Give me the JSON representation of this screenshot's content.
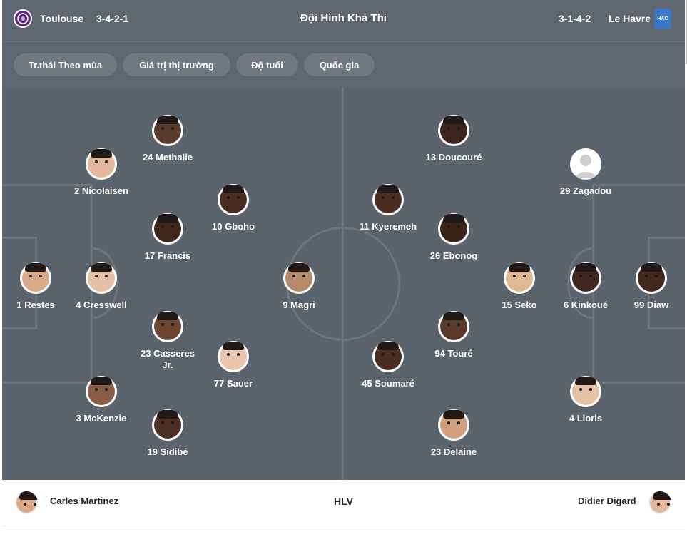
{
  "header": {
    "home_team": "Toulouse",
    "home_formation": "3-4-2-1",
    "title": "Đội Hình Khả Thi",
    "away_formation": "3-1-4-2",
    "away_team": "Le Havre",
    "away_logo_text": "HAC",
    "home_logo_icon": "toulouse-crest-icon",
    "away_logo_icon": "le-havre-crest-icon"
  },
  "tabs": [
    "Tr.thái Theo mùa",
    "Giá trị thị trường",
    "Độ tuổi",
    "Quốc gia"
  ],
  "home_players": [
    {
      "label": "24 Methalie",
      "skin": "#5a3a2a"
    },
    {
      "label": "2 Nicolaisen",
      "skin": "#e2b79a"
    },
    {
      "label": "10 Gboho",
      "skin": "#4a2e22"
    },
    {
      "label": "17 Francis",
      "skin": "#3f271c"
    },
    {
      "label": "1 Restes",
      "skin": "#d9a988"
    },
    {
      "label": "4 Cresswell",
      "skin": "#e6c0a4"
    },
    {
      "label": "9 Magri",
      "skin": "#b58a6a"
    },
    {
      "label": "23 Casseres Jr.",
      "skin": "#6b4532"
    },
    {
      "label": "77 Sauer",
      "skin": "#e8c6ad"
    },
    {
      "label": "3 McKenzie",
      "skin": "#8a5e44"
    },
    {
      "label": "19 Sidibé",
      "skin": "#4c2f22"
    }
  ],
  "away_players": [
    {
      "label": "13 Doucouré",
      "skin": "#3b251b"
    },
    {
      "label": "29 Zagadou",
      "skin": "placeholder"
    },
    {
      "label": "11 Kyeremeh",
      "skin": "#4a2e21"
    },
    {
      "label": "26 Ebonog",
      "skin": "#3a2419"
    },
    {
      "label": "15 Seko",
      "skin": "#e0b894"
    },
    {
      "label": "6 Kinkoué",
      "skin": "#3e271c"
    },
    {
      "label": "99 Diaw",
      "skin": "#43291d"
    },
    {
      "label": "94 Touré",
      "skin": "#5a3b2b"
    },
    {
      "label": "45 Soumaré",
      "skin": "#4a2e21"
    },
    {
      "label": "4 Lloris",
      "skin": "#e7c3a6"
    },
    {
      "label": "23 Delaine",
      "skin": "#d2a07e"
    }
  ],
  "coaches": {
    "home_name": "Carles Martinez",
    "label": "HLV",
    "away_name": "Didier Digard",
    "home_skin": "#d9a988",
    "away_skin": "#e2b79a"
  },
  "colors": {
    "header_bg": "#5e6670",
    "pitch_bg": "#5b636d",
    "pitch_lines": "#6c747e",
    "tab_bg": "#6f7780",
    "home_crest": "#5b2c7a",
    "away_crest": "#3a78c5"
  }
}
